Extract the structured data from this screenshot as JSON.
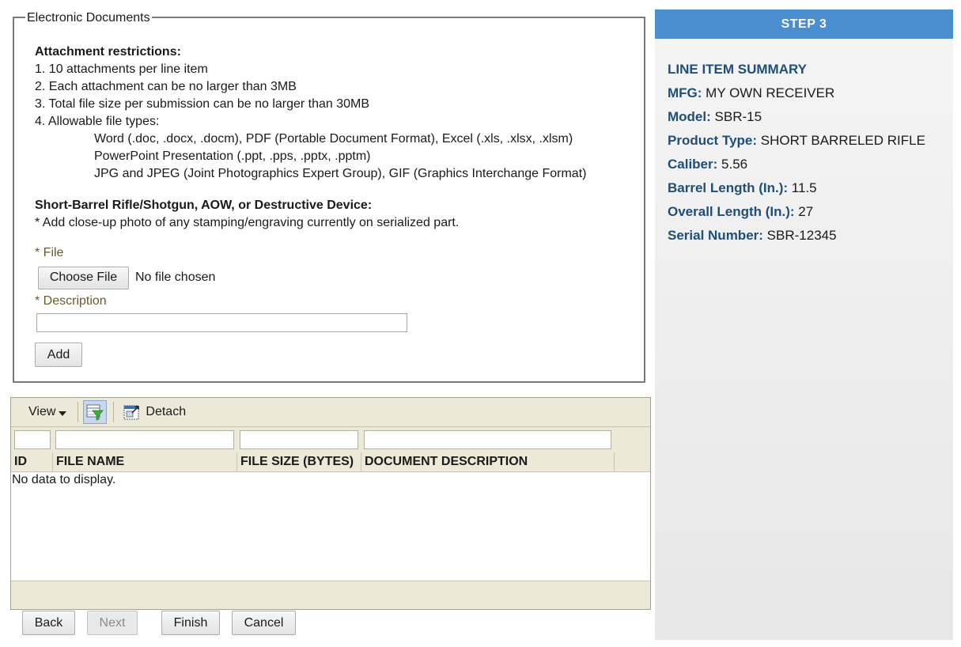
{
  "documents": {
    "legend": "Electronic Documents",
    "restrictions_title": "Attachment restrictions:",
    "restrictions": [
      "1. 10 attachments per line item",
      "2. Each attachment can be no larger than 3MB",
      "3. Total file size per submission can be no larger than 30MB",
      "4. Allowable file types:"
    ],
    "file_types": [
      "Word (.doc, .docx, .docm), PDF (Portable Document Format), Excel (.xls, .xlsx, .xlsm)",
      "PowerPoint Presentation (.ppt, .pps, .pptx, .pptm)",
      "JPG and JPEG (Joint Photographics Expert Group), GIF (Graphics Interchange Format)"
    ],
    "sbr_title": "Short-Barrel Rifle/Shotgun, AOW, or Destructive Device:",
    "sbr_note": "* Add close-up photo of any stamping/engraving currently on serialized part.",
    "file_label": "* File",
    "choose_file_label": "Choose File",
    "no_file_text": "No file chosen",
    "description_label": "* Description",
    "description_value": "",
    "add_label": "Add"
  },
  "grid": {
    "view_label": "View",
    "detach_label": "Detach",
    "columns": [
      "ID",
      "FILE NAME",
      "FILE SIZE (BYTES)",
      "DOCUMENT DESCRIPTION"
    ],
    "empty_text": "No data to display."
  },
  "buttons": {
    "back": "Back",
    "next": "Next",
    "finish": "Finish",
    "cancel": "Cancel"
  },
  "summary": {
    "step": "STEP 3",
    "title": "LINE ITEM SUMMARY",
    "rows": [
      {
        "key": "MFG:",
        "value": "MY OWN RECEIVER"
      },
      {
        "key": "Model:",
        "value": "SBR-15"
      },
      {
        "key": "Product Type:",
        "value": "SHORT BARRELED RIFLE"
      },
      {
        "key": "Caliber:",
        "value": "5.56"
      },
      {
        "key": "Barrel Length (In.):",
        "value": "11.5"
      },
      {
        "key": "Overall Length (In.):",
        "value": "27"
      },
      {
        "key": "Serial Number:",
        "value": "SBR-12345"
      }
    ]
  },
  "colors": {
    "step_bar": "#4b8ed0",
    "summary_key": "#1f4e79",
    "field_label": "#6b5a2a",
    "grid_chrome": "#ece9d8"
  },
  "icons": [
    "filter-icon",
    "detach-icon",
    "chevron-down-icon"
  ]
}
